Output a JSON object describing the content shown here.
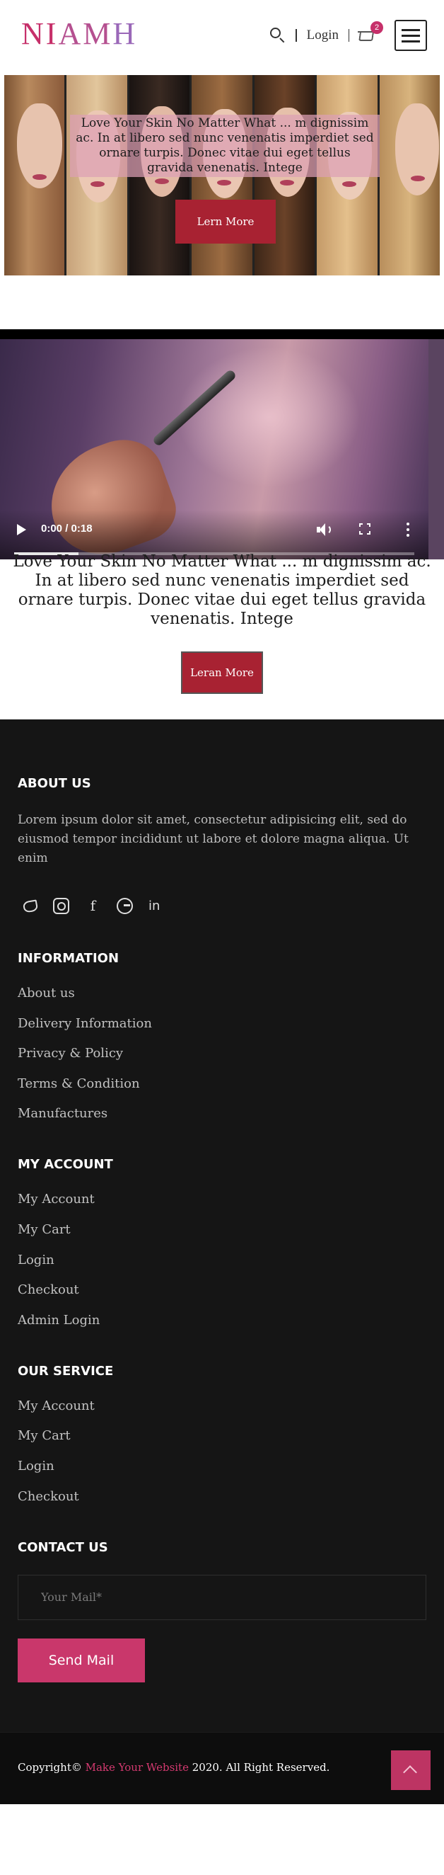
{
  "header": {
    "logo": "NIAMH",
    "login_label": "Login",
    "cart_count": "2"
  },
  "hero": {
    "text": "Love Your Skin No Matter What ... m dignissim ac. In at libero sed nunc venenatis imperdiet sed ornare turpis. Donec vitae dui eget tellus gravida venenatis. Intege",
    "button_label": "Lern More"
  },
  "video": {
    "time": "0:00 / 0:18",
    "progress": 0.16,
    "caption": "Love Your Skin No Matter What ... m dignissim ac. In at libero sed nunc venenatis imperdiet sed ornare turpis. Donec vitae dui eget tellus gravida venenatis. Intege",
    "button_label": "Leran More"
  },
  "footer": {
    "about": {
      "heading": "ABOUT US",
      "text": "Lorem ipsum dolor sit amet, consectetur adipisicing elit, sed do eiusmod tempor incididunt ut labore et dolore magna aliqua. Ut enim"
    },
    "social_icons": [
      "twitter-icon",
      "instagram-icon",
      "facebook-icon",
      "google-icon",
      "linkedin-icon"
    ],
    "information": {
      "heading": "INFORMATION",
      "items": [
        "About us",
        "Delivery Information",
        "Privacy & Policy",
        "Terms & Condition",
        "Manufactures"
      ]
    },
    "my_account": {
      "heading": "MY ACCOUNT",
      "items": [
        "My Account",
        "My Cart",
        "Login",
        "Checkout",
        "Admin Login"
      ]
    },
    "our_service": {
      "heading": "OUR SERVICE",
      "items": [
        "My Account",
        "My Cart",
        "Login",
        "Checkout"
      ]
    },
    "contact": {
      "heading": "CONTACT US",
      "placeholder": "Your Mail*",
      "button_label": "Send Mail"
    }
  },
  "bottom": {
    "copyright_prefix": "Copyright©",
    "brand": "Make Your Website",
    "copyright_suffix": "2020. All Right Reserved."
  },
  "colors": {
    "accent": "#c9376b",
    "button_red": "#a82232",
    "footer_bg": "#151515"
  }
}
